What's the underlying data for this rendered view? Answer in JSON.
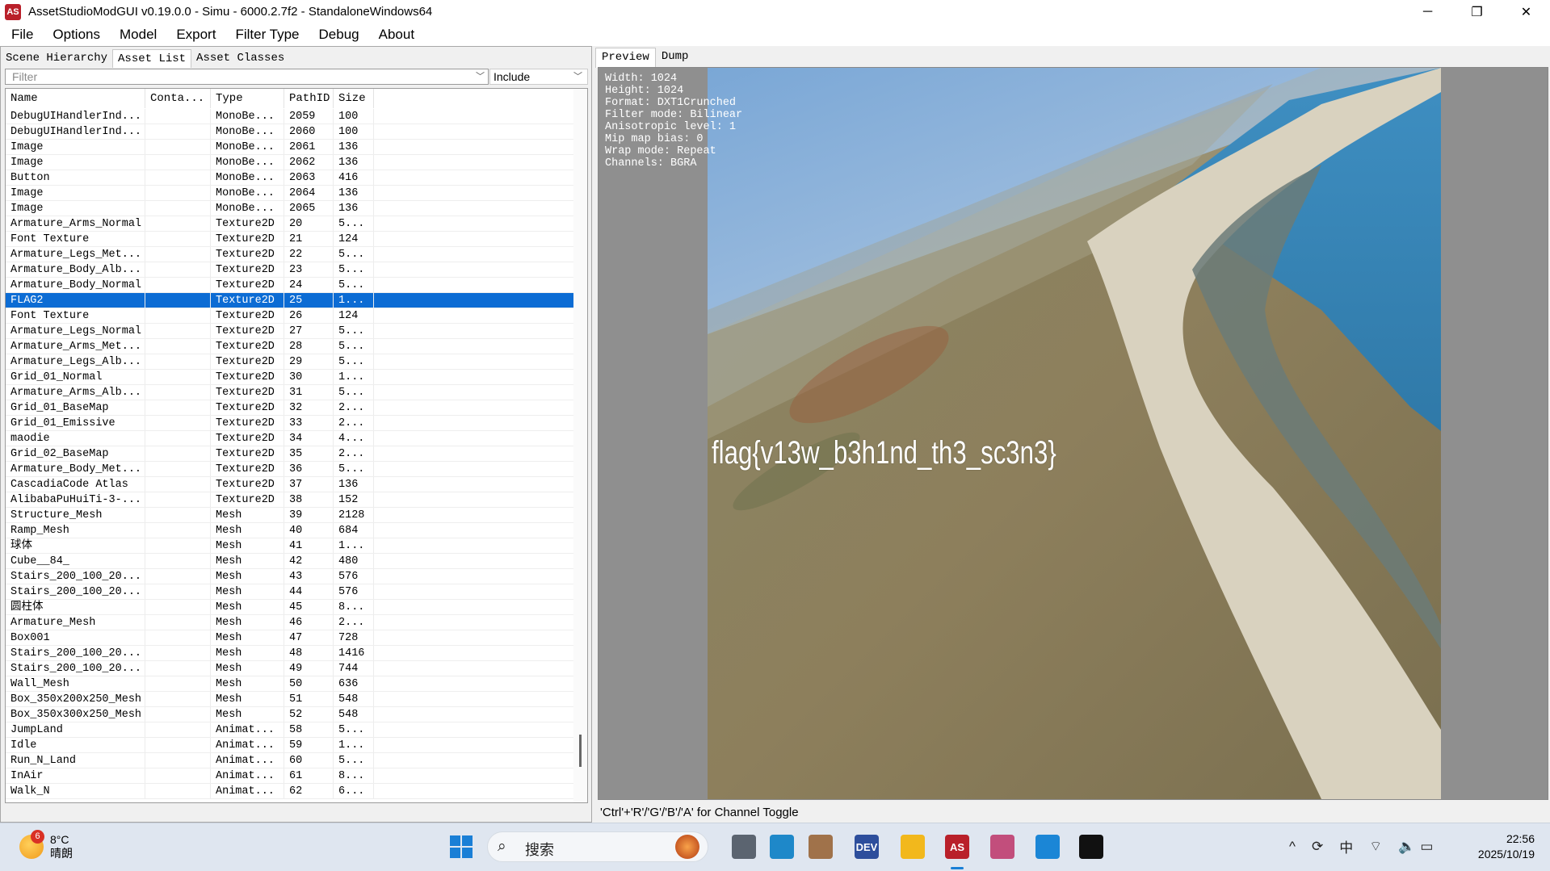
{
  "window": {
    "title": "AssetStudioModGUI v0.19.0.0 - Simu - 6000.2.7f2 - StandaloneWindows64",
    "app_icon_text": "AS",
    "minimize": "─",
    "maximize": "❐",
    "close": "✕"
  },
  "menu": [
    "File",
    "Options",
    "Model",
    "Export",
    "Filter Type",
    "Debug",
    "About"
  ],
  "left_tabs": [
    "Scene Hierarchy",
    "Asset List",
    "Asset Classes"
  ],
  "filter": {
    "placeholder": "Filter",
    "include": "Include"
  },
  "table": {
    "headers": [
      "Name",
      "Conta...",
      "Type",
      "PathID",
      "Size"
    ],
    "rows": [
      [
        "DebugUIHandlerInd...",
        "",
        "MonoBe...",
        "2059",
        "100"
      ],
      [
        "DebugUIHandlerInd...",
        "",
        "MonoBe...",
        "2060",
        "100"
      ],
      [
        "Image",
        "",
        "MonoBe...",
        "2061",
        "136"
      ],
      [
        "Image",
        "",
        "MonoBe...",
        "2062",
        "136"
      ],
      [
        "Button",
        "",
        "MonoBe...",
        "2063",
        "416"
      ],
      [
        "Image",
        "",
        "MonoBe...",
        "2064",
        "136"
      ],
      [
        "Image",
        "",
        "MonoBe...",
        "2065",
        "136"
      ],
      [
        "Armature_Arms_Normal",
        "",
        "Texture2D",
        "20",
        "5..."
      ],
      [
        "Font Texture",
        "",
        "Texture2D",
        "21",
        "124"
      ],
      [
        "Armature_Legs_Met...",
        "",
        "Texture2D",
        "22",
        "5..."
      ],
      [
        "Armature_Body_Alb...",
        "",
        "Texture2D",
        "23",
        "5..."
      ],
      [
        "Armature_Body_Normal",
        "",
        "Texture2D",
        "24",
        "5..."
      ],
      [
        "FLAG2",
        "",
        "Texture2D",
        "25",
        "1..."
      ],
      [
        "Font Texture",
        "",
        "Texture2D",
        "26",
        "124"
      ],
      [
        "Armature_Legs_Normal",
        "",
        "Texture2D",
        "27",
        "5..."
      ],
      [
        "Armature_Arms_Met...",
        "",
        "Texture2D",
        "28",
        "5..."
      ],
      [
        "Armature_Legs_Alb...",
        "",
        "Texture2D",
        "29",
        "5..."
      ],
      [
        "Grid_01_Normal",
        "",
        "Texture2D",
        "30",
        "1..."
      ],
      [
        "Armature_Arms_Alb...",
        "",
        "Texture2D",
        "31",
        "5..."
      ],
      [
        "Grid_01_BaseMap",
        "",
        "Texture2D",
        "32",
        "2..."
      ],
      [
        "Grid_01_Emissive",
        "",
        "Texture2D",
        "33",
        "2..."
      ],
      [
        "maodie",
        "",
        "Texture2D",
        "34",
        "4..."
      ],
      [
        "Grid_02_BaseMap",
        "",
        "Texture2D",
        "35",
        "2..."
      ],
      [
        "Armature_Body_Met...",
        "",
        "Texture2D",
        "36",
        "5..."
      ],
      [
        "CascadiaCode Atlas",
        "",
        "Texture2D",
        "37",
        "136"
      ],
      [
        "AlibabaPuHuiTi-3-...",
        "",
        "Texture2D",
        "38",
        "152"
      ],
      [
        "Structure_Mesh",
        "",
        "Mesh",
        "39",
        "2128"
      ],
      [
        "Ramp_Mesh",
        "",
        "Mesh",
        "40",
        "684"
      ],
      [
        "球体",
        "",
        "Mesh",
        "41",
        "1..."
      ],
      [
        "Cube__84_",
        "",
        "Mesh",
        "42",
        "480"
      ],
      [
        "Stairs_200_100_20...",
        "",
        "Mesh",
        "43",
        "576"
      ],
      [
        "Stairs_200_100_20...",
        "",
        "Mesh",
        "44",
        "576"
      ],
      [
        "圆柱体",
        "",
        "Mesh",
        "45",
        "8..."
      ],
      [
        "Armature_Mesh",
        "",
        "Mesh",
        "46",
        "2..."
      ],
      [
        "Box001",
        "",
        "Mesh",
        "47",
        "728"
      ],
      [
        "Stairs_200_100_20...",
        "",
        "Mesh",
        "48",
        "1416"
      ],
      [
        "Stairs_200_100_20...",
        "",
        "Mesh",
        "49",
        "744"
      ],
      [
        "Wall_Mesh",
        "",
        "Mesh",
        "50",
        "636"
      ],
      [
        "Box_350x200x250_Mesh",
        "",
        "Mesh",
        "51",
        "548"
      ],
      [
        "Box_350x300x250_Mesh",
        "",
        "Mesh",
        "52",
        "548"
      ],
      [
        "JumpLand",
        "",
        "Animat...",
        "58",
        "5..."
      ],
      [
        "Idle",
        "",
        "Animat...",
        "59",
        "1..."
      ],
      [
        "Run_N_Land",
        "",
        "Animat...",
        "60",
        "5..."
      ],
      [
        "InAir",
        "",
        "Animat...",
        "61",
        "8..."
      ],
      [
        "Walk_N",
        "",
        "Animat...",
        "62",
        "6..."
      ]
    ],
    "selected_index": 12
  },
  "progress": {
    "fraction": 1.0,
    "color": "#11a32a"
  },
  "right_tabs": [
    "Preview",
    "Dump"
  ],
  "preview": {
    "info_lines": [
      "Width: 1024",
      "Height: 1024",
      "Format: DXT1Crunched",
      "Filter mode: Bilinear",
      "Anisotropic level: 1",
      "Mip map bias: 0",
      "Wrap mode: Repeat",
      "Channels: BGRA"
    ],
    "flag_text": "flag{v13w_b3h1nd_th3_sc3n3}",
    "image_icon": "aerial-landscape-image"
  },
  "status_hint": "'Ctrl'+'R'/'G'/'B'/'A' for Channel Toggle",
  "taskbar": {
    "weather_badge": "6",
    "temperature": "8°C",
    "condition": "晴朗",
    "search_placeholder": "搜索",
    "apps": [
      {
        "name": "task-view-icon",
        "label": "",
        "color": "#5b6470"
      },
      {
        "name": "edge-icon",
        "label": "",
        "color": "#1e88c9"
      },
      {
        "name": "figure-app-icon",
        "label": "",
        "color": "#a0724a"
      },
      {
        "name": "devcpp-icon",
        "label": "DEV",
        "color": "#2d4e9c"
      },
      {
        "name": "file-explorer-icon",
        "label": "",
        "color": "#f2b81c"
      },
      {
        "name": "assetstudio-icon",
        "label": "AS",
        "color": "#b9202a"
      },
      {
        "name": "snipping-tool-icon",
        "label": "",
        "color": "#c24e7c"
      },
      {
        "name": "store-app-icon",
        "label": "",
        "color": "#1b86d6"
      },
      {
        "name": "qq-icon",
        "label": "",
        "color": "#111111"
      }
    ],
    "tray": {
      "chevron": "^",
      "sync": "⟳",
      "ime": "中",
      "wifi": "⌔",
      "volume": "🔈",
      "battery": "▭"
    },
    "time": "22:56",
    "date": "2025/10/19"
  }
}
